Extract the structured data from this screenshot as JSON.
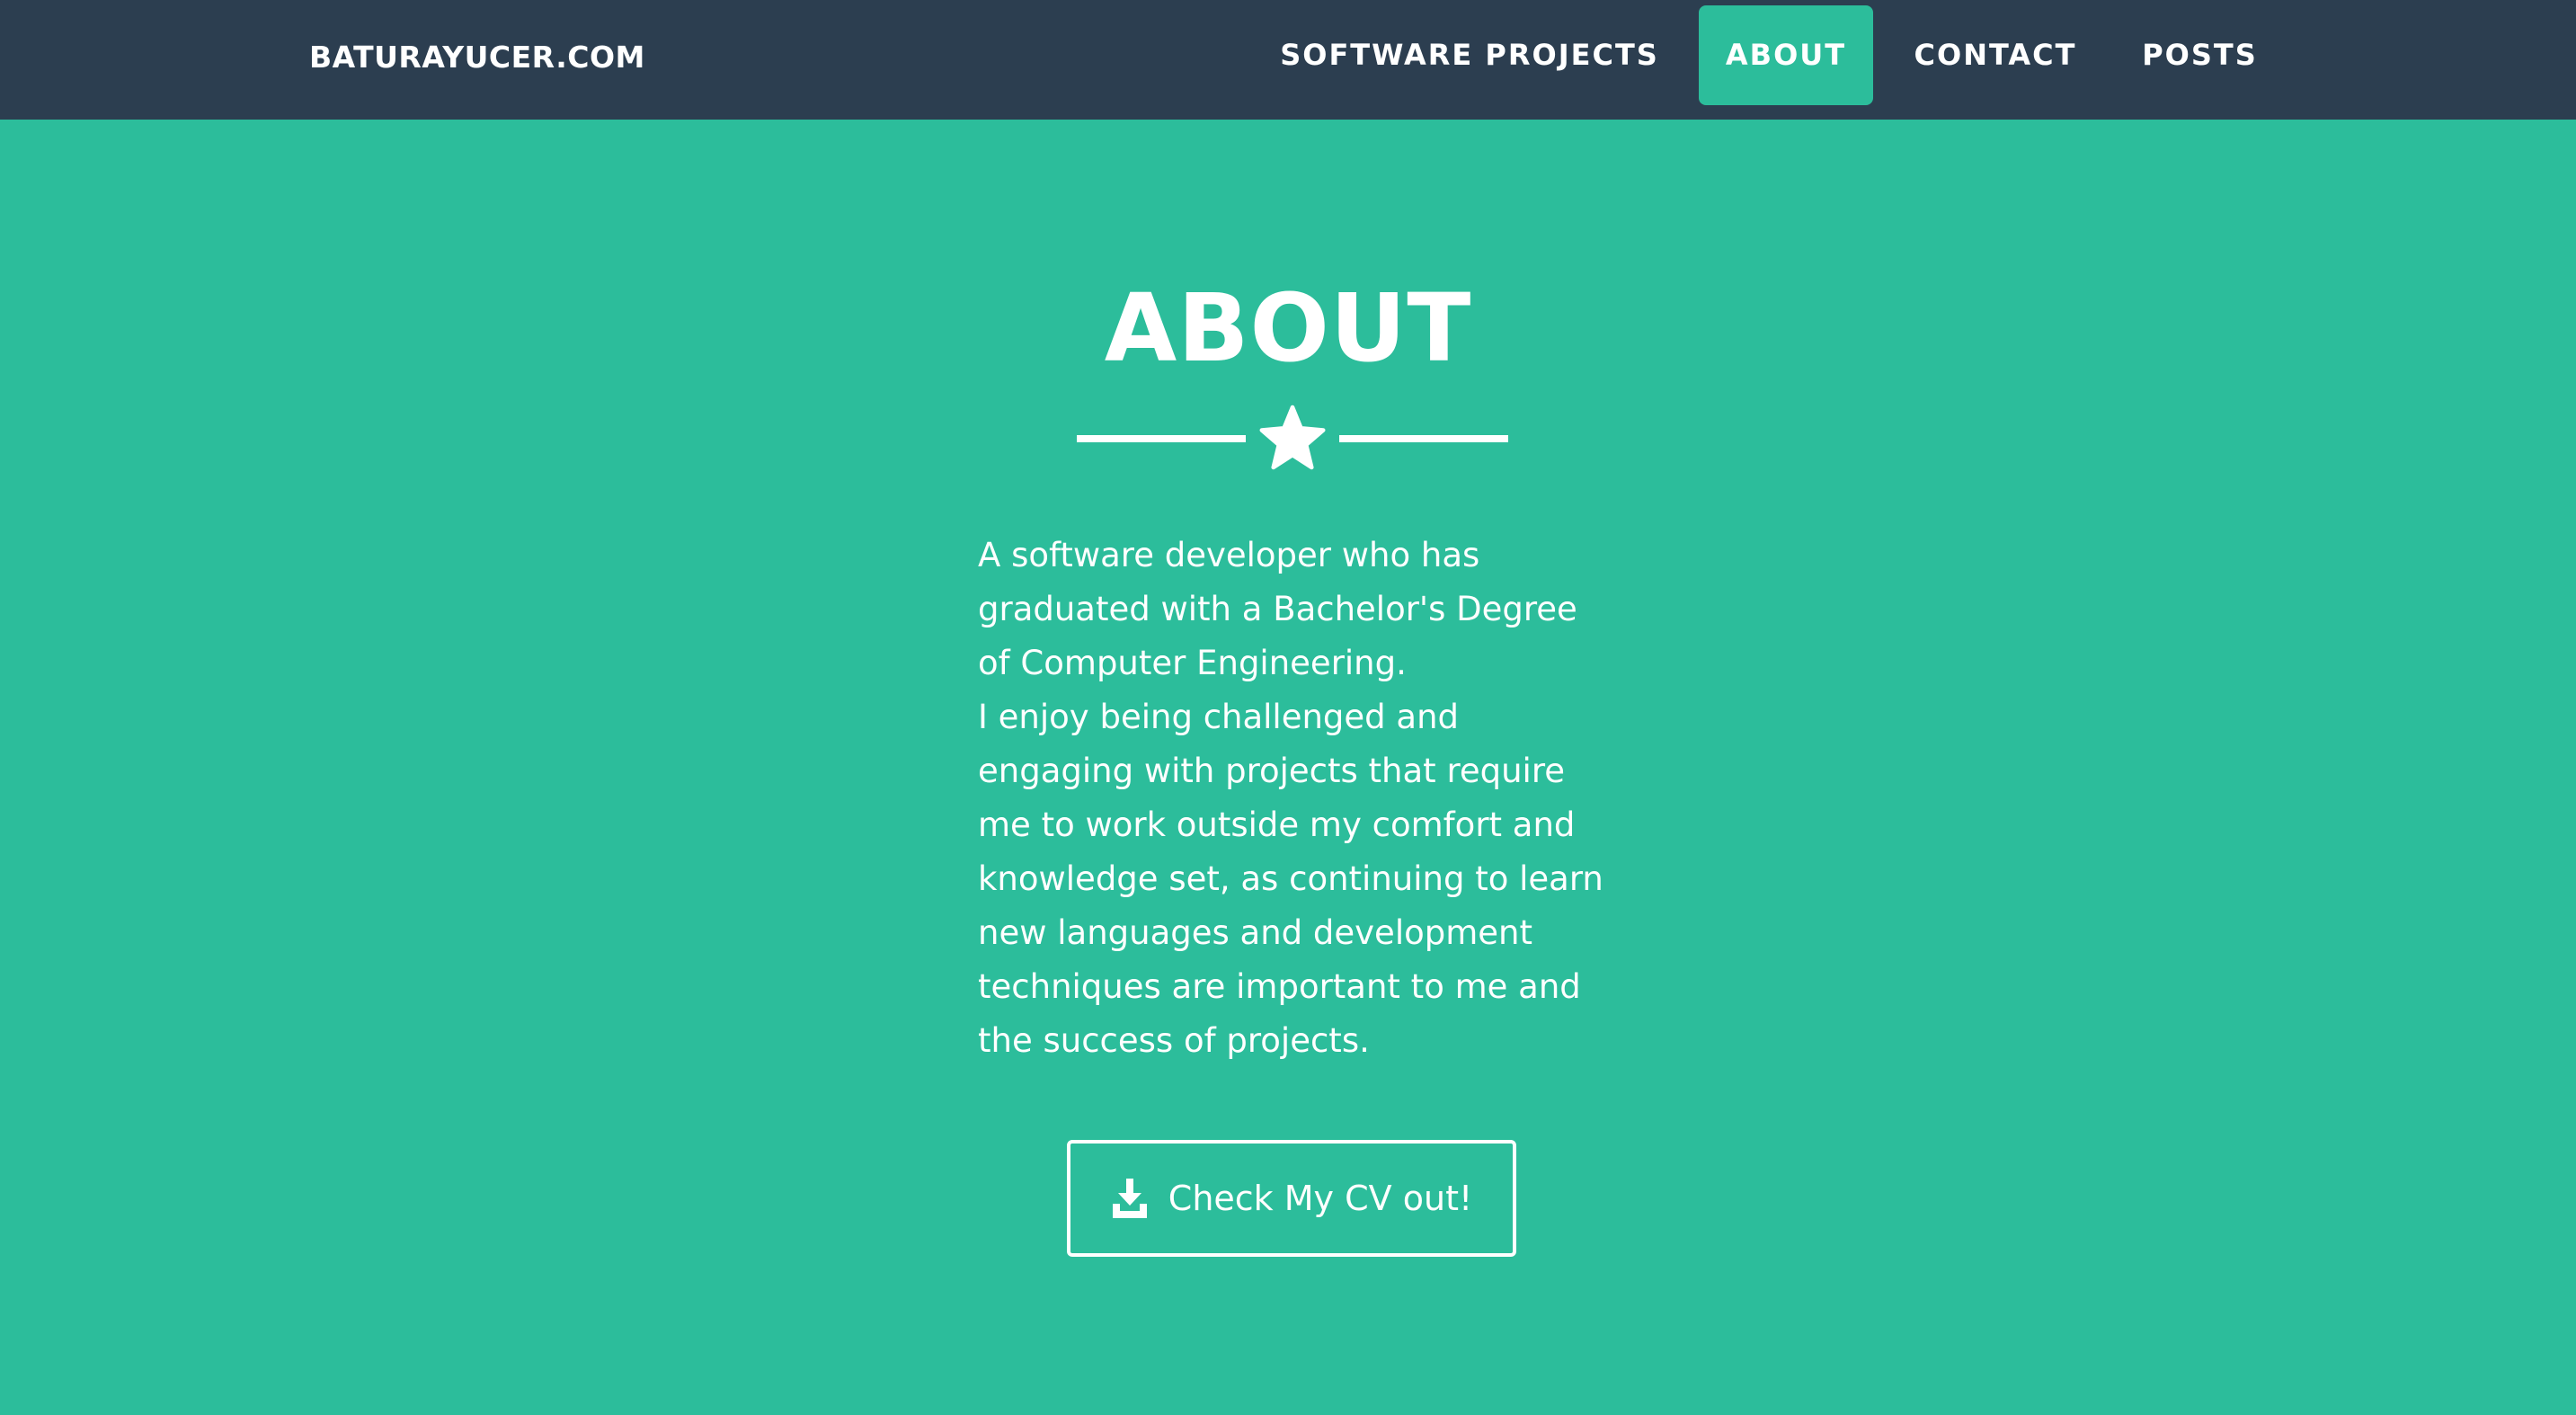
{
  "navbar": {
    "brand": "BATURAYUCER.COM",
    "items": [
      {
        "label": "SOFTWARE PROJECTS",
        "active": false
      },
      {
        "label": "ABOUT",
        "active": true
      },
      {
        "label": "CONTACT",
        "active": false
      },
      {
        "label": "POSTS",
        "active": false
      }
    ]
  },
  "about": {
    "title": "ABOUT",
    "divider_icon": "star-icon",
    "paragraph_1": "A software developer who has graduated with a Bachelor's Degree of Computer Engineering.",
    "paragraph_2": "I enjoy being challenged and engaging with projects that require me to work outside my comfort and knowledge set, as continuing to learn new languages and development techniques are important to me and the success of projects.",
    "cv_button": {
      "label": "Check My CV out!",
      "icon": "download-icon"
    }
  },
  "colors": {
    "navbar_background": "#2c3e50",
    "primary_background": "#2cbd9b",
    "text": "#ffffff"
  }
}
